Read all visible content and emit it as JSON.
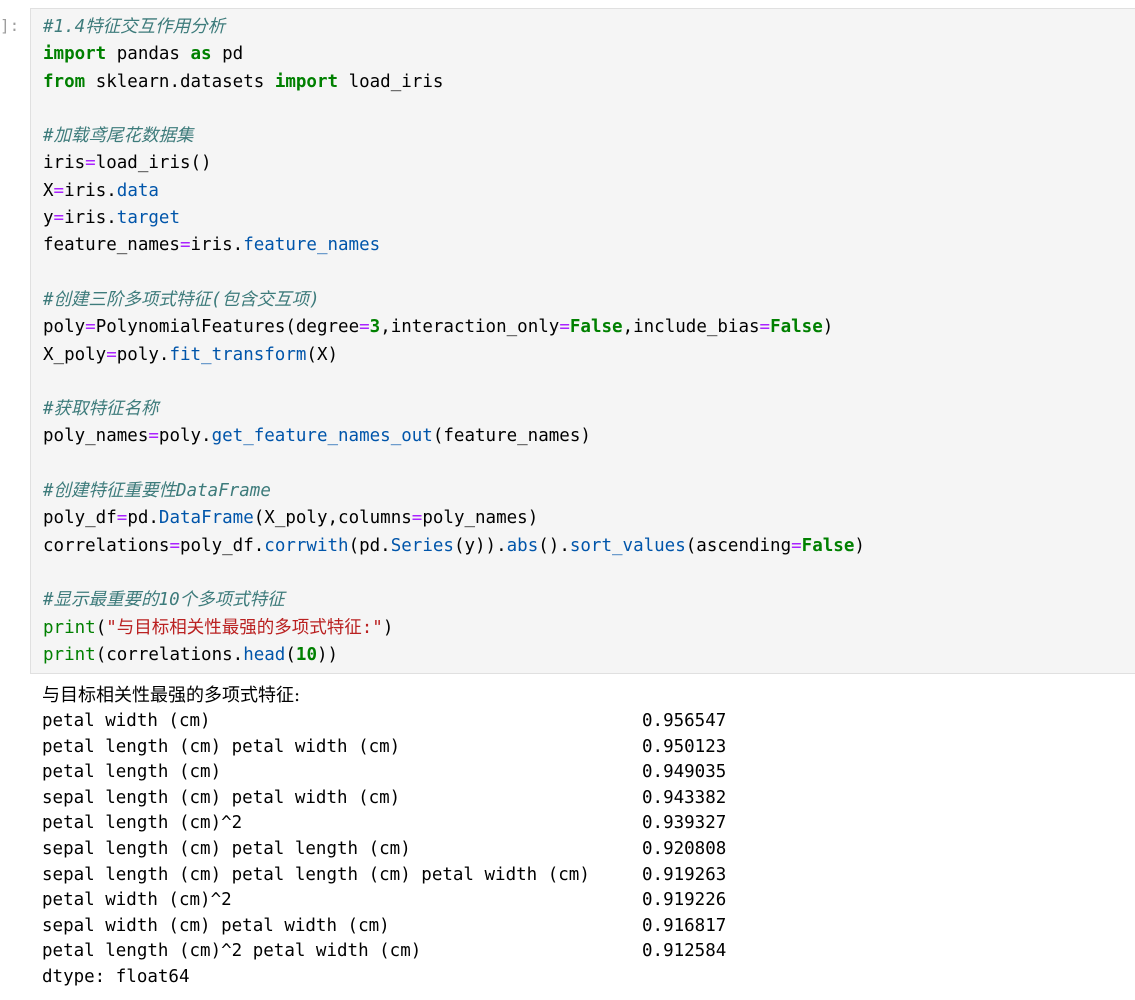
{
  "cell": {
    "prompt": "]:"
  },
  "code_lines": [
    [
      {
        "t": "#1.4",
        "c": "cm"
      },
      {
        "t": "特征交互作用分析",
        "c": "cmcjk"
      }
    ],
    [
      {
        "t": "import",
        "c": "kw"
      },
      {
        "t": " pandas ",
        "c": ""
      },
      {
        "t": "as",
        "c": "kw"
      },
      {
        "t": " pd",
        "c": ""
      }
    ],
    [
      {
        "t": "from",
        "c": "kw"
      },
      {
        "t": " sklearn.datasets ",
        "c": ""
      },
      {
        "t": "import",
        "c": "kw"
      },
      {
        "t": " load_iris",
        "c": ""
      }
    ],
    [],
    [
      {
        "t": "#",
        "c": "cm"
      },
      {
        "t": "加载鸢尾花数据集",
        "c": "cmcjk"
      }
    ],
    [
      {
        "t": "iris",
        "c": ""
      },
      {
        "t": "=",
        "c": "op"
      },
      {
        "t": "load_iris()",
        "c": ""
      }
    ],
    [
      {
        "t": "X",
        "c": ""
      },
      {
        "t": "=",
        "c": "op"
      },
      {
        "t": "iris.",
        "c": ""
      },
      {
        "t": "data",
        "c": "attr"
      }
    ],
    [
      {
        "t": "y",
        "c": ""
      },
      {
        "t": "=",
        "c": "op"
      },
      {
        "t": "iris.",
        "c": ""
      },
      {
        "t": "target",
        "c": "attr"
      }
    ],
    [
      {
        "t": "feature_names",
        "c": ""
      },
      {
        "t": "=",
        "c": "op"
      },
      {
        "t": "iris.",
        "c": ""
      },
      {
        "t": "feature_names",
        "c": "attr"
      }
    ],
    [],
    [
      {
        "t": "#",
        "c": "cm"
      },
      {
        "t": "创建三阶多项式特征",
        "c": "cmcjk"
      },
      {
        "t": "(",
        "c": "cm"
      },
      {
        "t": "包含交互项",
        "c": "cmcjk"
      },
      {
        "t": ")",
        "c": "cm"
      }
    ],
    [
      {
        "t": "poly",
        "c": ""
      },
      {
        "t": "=",
        "c": "op"
      },
      {
        "t": "PolynomialFeatures(degree",
        "c": ""
      },
      {
        "t": "=",
        "c": "op"
      },
      {
        "t": "3",
        "c": "num"
      },
      {
        "t": ",interaction_only",
        "c": ""
      },
      {
        "t": "=",
        "c": "op"
      },
      {
        "t": "False",
        "c": "kw"
      },
      {
        "t": ",include_bias",
        "c": ""
      },
      {
        "t": "=",
        "c": "op"
      },
      {
        "t": "False",
        "c": "kw"
      },
      {
        "t": ")",
        "c": ""
      }
    ],
    [
      {
        "t": "X_poly",
        "c": ""
      },
      {
        "t": "=",
        "c": "op"
      },
      {
        "t": "poly.",
        "c": ""
      },
      {
        "t": "fit_transform",
        "c": "attr"
      },
      {
        "t": "(X)",
        "c": ""
      }
    ],
    [],
    [
      {
        "t": "#",
        "c": "cm"
      },
      {
        "t": "获取特征名称",
        "c": "cmcjk"
      }
    ],
    [
      {
        "t": "poly_names",
        "c": ""
      },
      {
        "t": "=",
        "c": "op"
      },
      {
        "t": "poly.",
        "c": ""
      },
      {
        "t": "get_feature_names_out",
        "c": "attr"
      },
      {
        "t": "(feature_names)",
        "c": ""
      }
    ],
    [],
    [
      {
        "t": "#",
        "c": "cm"
      },
      {
        "t": "创建特征重要性",
        "c": "cmcjk"
      },
      {
        "t": "DataFrame",
        "c": "cm"
      }
    ],
    [
      {
        "t": "poly_df",
        "c": ""
      },
      {
        "t": "=",
        "c": "op"
      },
      {
        "t": "pd.",
        "c": ""
      },
      {
        "t": "DataFrame",
        "c": "attr"
      },
      {
        "t": "(X_poly,columns",
        "c": ""
      },
      {
        "t": "=",
        "c": "op"
      },
      {
        "t": "poly_names)",
        "c": ""
      }
    ],
    [
      {
        "t": "correlations",
        "c": ""
      },
      {
        "t": "=",
        "c": "op"
      },
      {
        "t": "poly_df.",
        "c": ""
      },
      {
        "t": "corrwith",
        "c": "attr"
      },
      {
        "t": "(pd.",
        "c": ""
      },
      {
        "t": "Series",
        "c": "attr"
      },
      {
        "t": "(y)).",
        "c": ""
      },
      {
        "t": "abs",
        "c": "attr"
      },
      {
        "t": "().",
        "c": ""
      },
      {
        "t": "sort_values",
        "c": "attr"
      },
      {
        "t": "(ascending",
        "c": ""
      },
      {
        "t": "=",
        "c": "op"
      },
      {
        "t": "False",
        "c": "kw"
      },
      {
        "t": ")",
        "c": ""
      }
    ],
    [],
    [
      {
        "t": "#",
        "c": "cm"
      },
      {
        "t": "显示最重要的",
        "c": "cmcjk"
      },
      {
        "t": "10",
        "c": "cm"
      },
      {
        "t": "个多项式特征",
        "c": "cmcjk"
      }
    ],
    [
      {
        "t": "print",
        "c": "builtin"
      },
      {
        "t": "(",
        "c": ""
      },
      {
        "t": "\"与目标相关性最强的多项式特征:\"",
        "c": "str"
      },
      {
        "t": ")",
        "c": ""
      }
    ],
    [
      {
        "t": "print",
        "c": "builtin"
      },
      {
        "t": "(correlations.",
        "c": ""
      },
      {
        "t": "head",
        "c": "attr"
      },
      {
        "t": "(",
        "c": ""
      },
      {
        "t": "10",
        "c": "num"
      },
      {
        "t": "))",
        "c": ""
      }
    ]
  ],
  "output": {
    "title": "与目标相关性最强的多项式特征:",
    "rows": [
      {
        "name": "petal width (cm)",
        "value": "0.956547"
      },
      {
        "name": "petal length (cm) petal width (cm)",
        "value": "0.950123"
      },
      {
        "name": "petal length (cm)",
        "value": "0.949035"
      },
      {
        "name": "sepal length (cm) petal width (cm)",
        "value": "0.943382"
      },
      {
        "name": "petal length (cm)^2",
        "value": "0.939327"
      },
      {
        "name": "sepal length (cm) petal length (cm)",
        "value": "0.920808"
      },
      {
        "name": "sepal length (cm) petal length (cm) petal width (cm)",
        "value": "0.919263"
      },
      {
        "name": "petal width (cm)^2",
        "value": "0.919226"
      },
      {
        "name": "sepal width (cm) petal width (cm)",
        "value": "0.916817"
      },
      {
        "name": "petal length (cm)^2 petal width (cm)",
        "value": "0.912584"
      }
    ],
    "dtype": "dtype: float64"
  },
  "colors": {
    "keyword": "#008000",
    "operator": "#aa22ff",
    "string": "#ba2121",
    "attribute": "#0055aa",
    "comment": "#3d7b7b",
    "input_background": "#f5f5f5"
  }
}
